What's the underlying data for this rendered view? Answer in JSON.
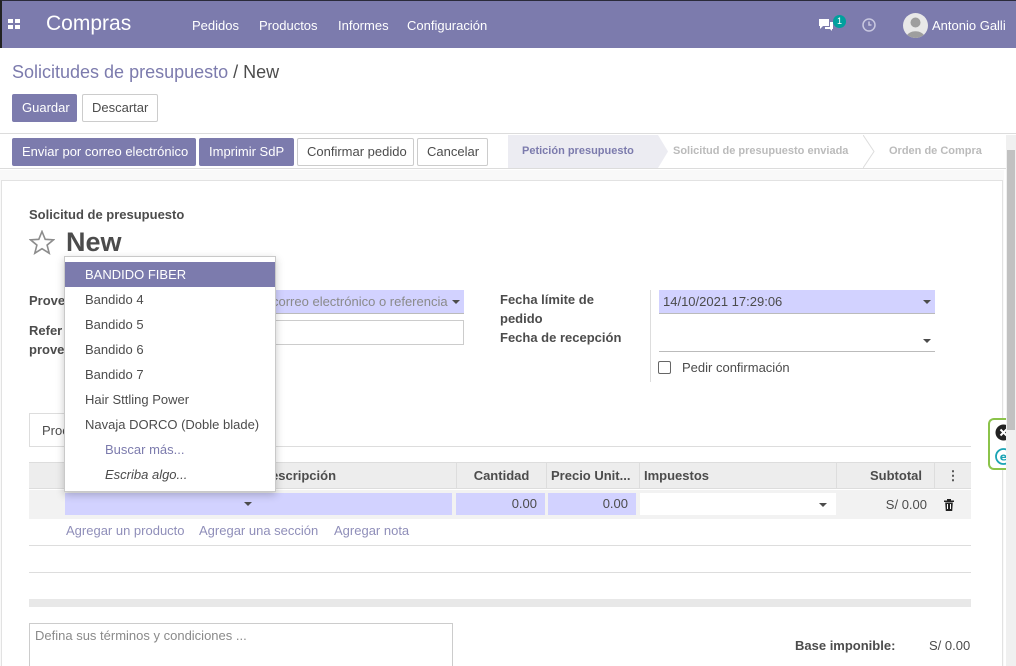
{
  "navbar": {
    "app_title": "Compras",
    "menus": [
      "Pedidos",
      "Productos",
      "Informes",
      "Configuración"
    ],
    "chat_count": "1",
    "user_name": "Antonio Galli"
  },
  "breadcrumb": {
    "parent": "Solicitudes de presupuesto",
    "separator": " / ",
    "current": "New"
  },
  "toolbar": {
    "save_label": "Guardar",
    "discard_label": "Descartar"
  },
  "actions": {
    "send_email": "Enviar por correo electrónico",
    "print": "Imprimir SdP",
    "confirm": "Confirmar pedido",
    "cancel": "Cancelar"
  },
  "status_steps": [
    {
      "label": "Petición presupuesto",
      "active": true
    },
    {
      "label": "Solicitud de presupuesto enviada",
      "active": false
    },
    {
      "label": "Orden de Compra",
      "active": false
    }
  ],
  "form": {
    "doc_type": "Solicitud de presupuesto",
    "name": "New",
    "vendor_label": "Prove",
    "vendor_placeholder": "correo electrónico o referencia",
    "vendor_ref_label_1": "Refer",
    "vendor_ref_label_2": "prove",
    "deadline_label_1": "Fecha límite de",
    "deadline_label_2": "pedido",
    "deadline_value": "14/10/2021 17:29:06",
    "receipt_label": "Fecha de recepción",
    "receipt_value": "",
    "ask_confirmation": "Pedir confirmación"
  },
  "notebook": {
    "tab_label": "Proc"
  },
  "lines_table": {
    "headers": [
      "escripción",
      "Cantidad",
      "Precio Unit...",
      "Impuestos",
      "Subtotal"
    ],
    "row": {
      "quantity": "0.00",
      "price": "0.00",
      "subtotal": "S/ 0.00"
    }
  },
  "line_actions": [
    "Agregar un producto",
    "Agregar una sección",
    "Agregar nota"
  ],
  "terms_placeholder": "Defina sus términos y condiciones ...",
  "totals": {
    "base_label": "Base imponible:",
    "base_value": "S/ 0.00"
  },
  "dropdown": {
    "items": [
      "BANDIDO FIBER",
      "Bandido 4",
      "Bandido 5",
      "Bandido 6",
      "Bandido 7",
      "Hair Sttling Power",
      "Navaja DORCO (Doble blade)"
    ],
    "search_more": "Buscar más...",
    "hint": "Escriba algo..."
  },
  "colors": {
    "brand": "#7c7bad",
    "required_bg": "#d2d2ff"
  }
}
